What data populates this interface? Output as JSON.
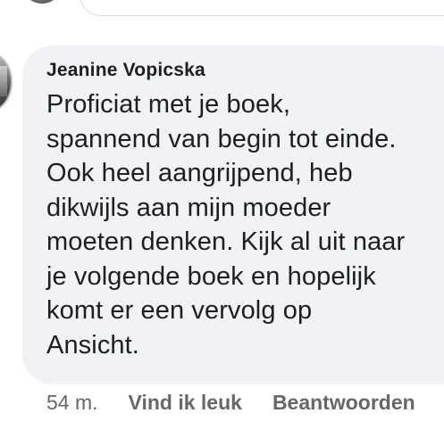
{
  "comment": {
    "author": "Jeanine Vopicska",
    "text": "Proficiat met je boek,\nspannend van begin tot einde.\nOok heel aangrijpend, heb\ndikwijls aan mijn moeder\nmoeten denken. Kijk al uit naar\nje volgende boek en hopelijk\nkomt er een vervolg op\nAnsicht.",
    "timestamp": "54 m.",
    "like_label": "Vind ik leuk",
    "reply_label": "Beantwoorden"
  },
  "colors": {
    "bubble_background": "#f0f2f5",
    "text": "#1c1e21",
    "meta_text": "#65676b"
  }
}
